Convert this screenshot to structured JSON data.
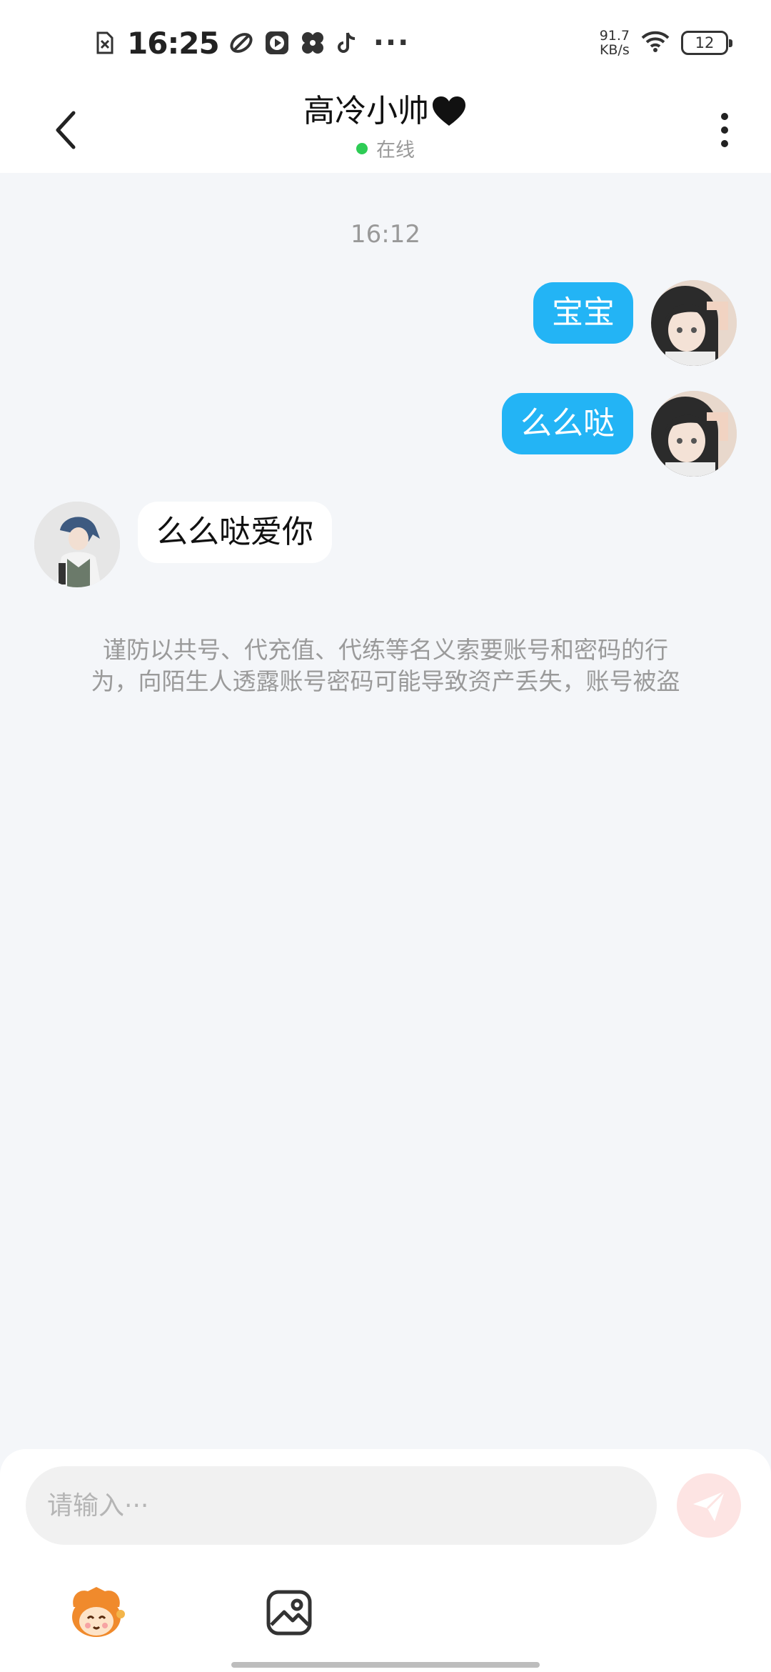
{
  "status_bar": {
    "time": "16:25",
    "dots": "···",
    "speed_value": "91.7",
    "speed_unit": "KB/s",
    "battery": "12",
    "icons": [
      "no-sim-icon",
      "leaf-app-icon",
      "video-app-icon",
      "fan-app-icon",
      "tiktok-icon",
      "wifi-icon",
      "battery-icon"
    ]
  },
  "header": {
    "title": "高冷小帅",
    "title_emoji": "black-heart-icon",
    "status": "在线",
    "status_color": "#2ecc55"
  },
  "chat": {
    "timestamp": "16:12",
    "messages": [
      {
        "from": "me",
        "text": "宝宝"
      },
      {
        "from": "me",
        "text": "么么哒"
      },
      {
        "from": "other",
        "text": "么么哒爱你"
      }
    ],
    "notice_lines": [
      "谨防以共号、代充值、代练等名义索要账号和密码的行",
      "为，向陌生人透露账号密码可能导致资产丢失，账号被盗"
    ]
  },
  "input": {
    "placeholder": "请输入···",
    "value": ""
  },
  "colors": {
    "my_bubble": "#23b4f5",
    "other_bubble": "#ffffff",
    "background": "#f4f6f9",
    "send_button": "#fde4e3"
  }
}
